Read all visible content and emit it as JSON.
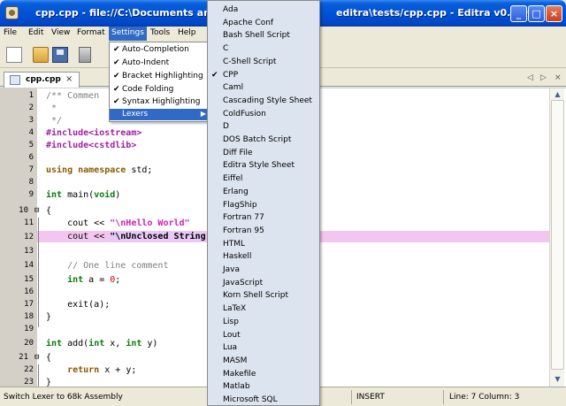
{
  "window": {
    "title_left": "cpp.cpp - file://C:\\Documents and Se",
    "title_right": "editra\\tests/cpp.cpp - Editra v0.2.0",
    "minimize": "_",
    "maximize": "□",
    "close": "×"
  },
  "menubar": {
    "file": "File",
    "edit": "Edit",
    "view": "View",
    "format": "Format",
    "settings": "Settings",
    "tools": "Tools",
    "help": "Help"
  },
  "tab": {
    "label": "cpp.cpp",
    "close": "×",
    "nav_left": "◁",
    "nav_right": "▷",
    "close_all": "×"
  },
  "settings_menu": {
    "items": [
      {
        "label": "Auto-Completion",
        "check": "✔"
      },
      {
        "label": "Auto-Indent",
        "check": "✔"
      },
      {
        "label": "Bracket Highlighting",
        "check": "✔"
      },
      {
        "label": "Code Folding",
        "check": "✔"
      },
      {
        "label": "Syntax Highlighting",
        "check": "✔"
      },
      {
        "label": "Lexers",
        "check": "",
        "arrow": "▶"
      }
    ]
  },
  "lexers": [
    {
      "label": "Ada"
    },
    {
      "label": "Apache Conf"
    },
    {
      "label": "Bash Shell Script"
    },
    {
      "label": "C"
    },
    {
      "label": "C-Shell Script"
    },
    {
      "label": "CPP",
      "check": "✔"
    },
    {
      "label": "Caml"
    },
    {
      "label": "Cascading Style Sheet"
    },
    {
      "label": "ColdFusion"
    },
    {
      "label": "D"
    },
    {
      "label": "DOS Batch Script"
    },
    {
      "label": "Diff File"
    },
    {
      "label": "Editra Style Sheet"
    },
    {
      "label": "Eiffel"
    },
    {
      "label": "Erlang"
    },
    {
      "label": "FlagShip"
    },
    {
      "label": "Fortran 77"
    },
    {
      "label": "Fortran 95"
    },
    {
      "label": "HTML"
    },
    {
      "label": "Haskell"
    },
    {
      "label": "Java"
    },
    {
      "label": "JavaScript"
    },
    {
      "label": "Korn Shell Script"
    },
    {
      "label": "LaTeX"
    },
    {
      "label": "Lisp"
    },
    {
      "label": "Lout"
    },
    {
      "label": "Lua"
    },
    {
      "label": "MASM"
    },
    {
      "label": "Makefile"
    },
    {
      "label": "Matlab"
    },
    {
      "label": "Microsoft SQL"
    }
  ],
  "code": {
    "line_numbers": [
      "1",
      "2",
      "3",
      "4",
      "5",
      "6",
      "7",
      "8",
      "9",
      "10",
      "11",
      "12",
      "13",
      "14",
      "15",
      "16",
      "17",
      "18",
      "19",
      "20",
      "21",
      "22",
      "23"
    ],
    "l1": "/** Commen",
    "l2": " *",
    "l3": " */",
    "l4": "#include<iostream>",
    "l5": "#include<cstdlib>",
    "l7a": "using namespace",
    "l7b": " std;",
    "l9a": "int",
    "l9b": " main(",
    "l9c": "void",
    "l9d": ")",
    "l10": "{",
    "l11a": "    cout << ",
    "l11b": "\"\\nHello World\"",
    "l12a": "    cout << ",
    "l12b": "\"\\nUnclosed String",
    "l14": "    // One line comment",
    "l15a": "    int",
    "l15b": " a = ",
    "l15c": "0",
    "l15d": ";",
    "l17": "    exit(a);",
    "l18": "}",
    "l20a": "int",
    "l20b": " add(",
    "l20c": "int",
    "l20d": " x, ",
    "l20e": "int",
    "l20f": " y)",
    "l21": "{",
    "l22a": "    return",
    "l22b": " x + y;",
    "l23": "}"
  },
  "statusbar": {
    "message": "Switch Lexer to 68k Assembly",
    "mode": "INSERT",
    "position": "Line: 7  Column: 3"
  }
}
